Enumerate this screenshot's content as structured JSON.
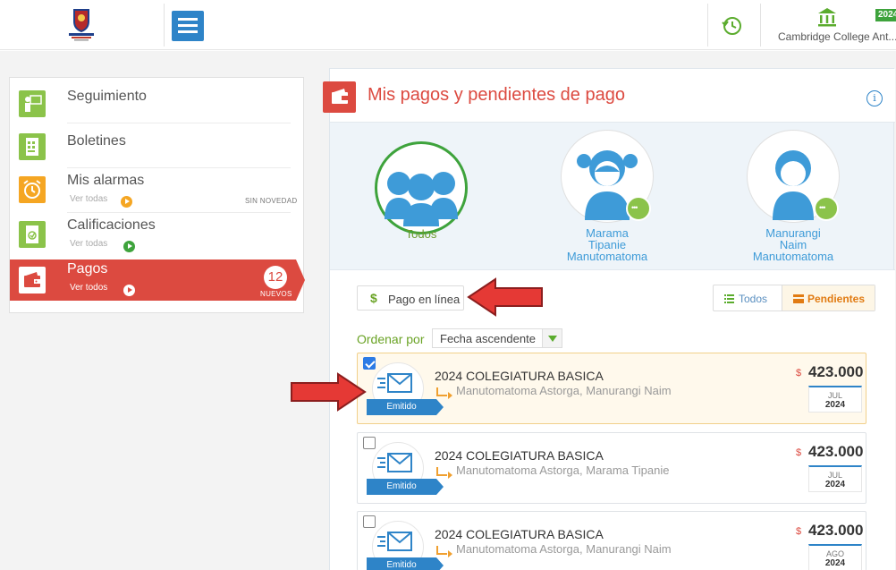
{
  "topbar": {
    "school_name": "Cambridge College Ant...",
    "year_badge": "2024"
  },
  "sidebar": {
    "items": [
      {
        "label": "Seguimiento",
        "icon": "person-board-icon",
        "color": "#8bc34a"
      },
      {
        "label": "Boletines",
        "icon": "report-card-icon",
        "color": "#8bc34a"
      },
      {
        "label": "Mis alarmas",
        "sub": "Ver todas",
        "status": "SIN NOVEDAD",
        "icon": "alarm-clock-icon",
        "color": "#f5a623"
      },
      {
        "label": "Calificaciones",
        "sub": "Ver todas",
        "icon": "grades-icon",
        "color": "#8bc34a"
      },
      {
        "label": "Pagos",
        "sub": "Ver todos",
        "count": "12",
        "badge": "NUEVOS",
        "icon": "wallet-icon",
        "color": "#dc4a40"
      }
    ]
  },
  "main": {
    "title": "Mis pagos y pendientes de pago",
    "info": "i",
    "students": [
      {
        "name": [
          "Todos"
        ],
        "selected": true
      },
      {
        "name": [
          "Marama",
          "Tipanie",
          "Manutomatoma"
        ],
        "selected": false
      },
      {
        "name": [
          "Manurangi",
          "Naim",
          "Manutomatoma"
        ],
        "selected": false
      }
    ],
    "pago_en_linea": "Pago en línea",
    "dollar": "$",
    "filter": {
      "todos": "Todos",
      "pendientes": "Pendientes"
    },
    "ordenar": {
      "label": "Ordenar por",
      "value": "Fecha ascendente"
    },
    "payments": [
      {
        "checked": true,
        "status": "Emitido",
        "title": "2024 COLEGIATURA BASICA",
        "names": "Manutomatoma Astorga, Manurangi Naim",
        "currency": "$",
        "amount": "423.000",
        "month": "JUL",
        "year": "2024"
      },
      {
        "checked": false,
        "status": "Emitido",
        "title": "2024 COLEGIATURA BASICA",
        "names": "Manutomatoma Astorga, Marama Tipanie",
        "currency": "$",
        "amount": "423.000",
        "month": "JUL",
        "year": "2024"
      },
      {
        "checked": false,
        "status": "Emitido",
        "title": "2024 COLEGIATURA BASICA",
        "names": "Manutomatoma Astorga, Manurangi Naim",
        "currency": "$",
        "amount": "423.000",
        "month": "AGO",
        "year": "2024"
      }
    ]
  }
}
